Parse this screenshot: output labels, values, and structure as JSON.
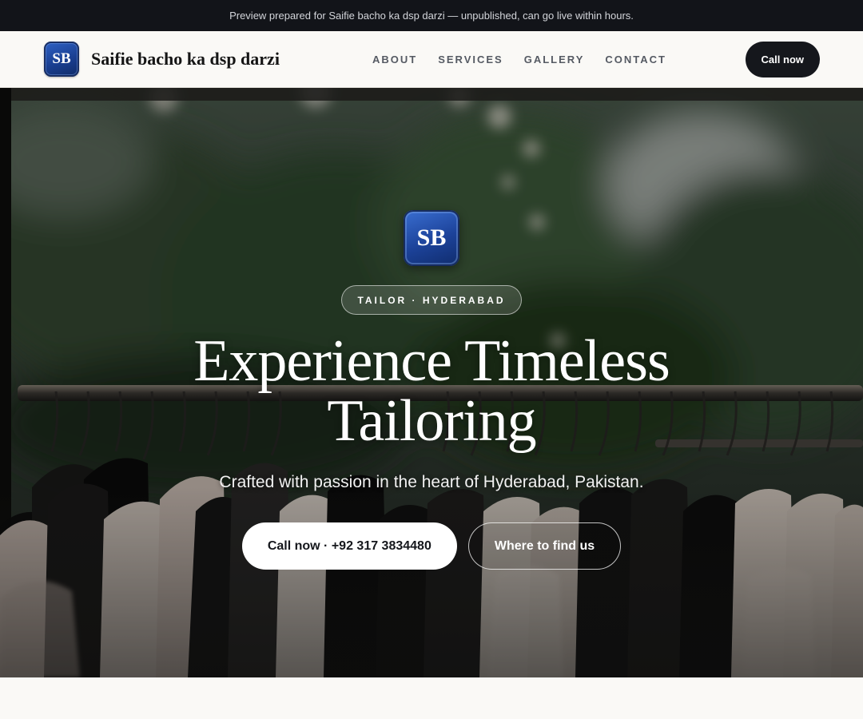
{
  "banner": {
    "text": "Preview prepared for Saifie bacho ka dsp darzi — unpublished, can go live within hours."
  },
  "nav": {
    "logo_initials": "SB",
    "brand_name": "Saifie bacho ka dsp darzi",
    "links": [
      {
        "label": "ABOUT"
      },
      {
        "label": "SERVICES"
      },
      {
        "label": "GALLERY"
      },
      {
        "label": "CONTACT"
      }
    ],
    "cta_label": "Call now"
  },
  "hero": {
    "badge_initials": "SB",
    "tag": "TAILOR · HYDERABAD",
    "title": "Experience Timeless Tailoring",
    "subtitle": "Crafted with passion in the heart of Hyderabad, Pakistan.",
    "primary_cta": "Call now · +92 317 3834480",
    "secondary_cta": "Where to find us",
    "background_image": "clothing-rack-photo"
  },
  "colors": {
    "banner_bg": "#121419",
    "nav_bg": "#faf9f6",
    "dark_button": "#15171c",
    "logo_blue": "#1a3f91"
  }
}
